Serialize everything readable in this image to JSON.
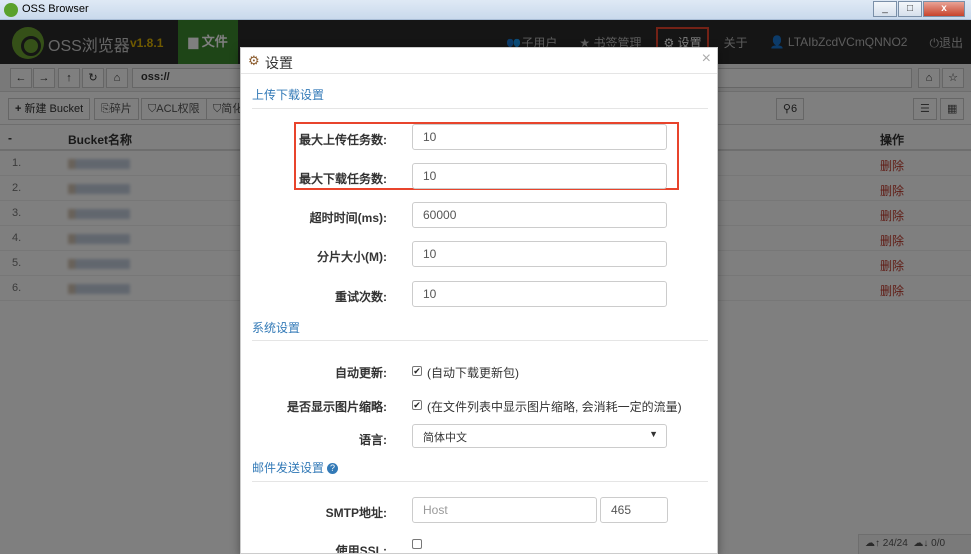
{
  "window": {
    "title": "OSS Browser",
    "minimize": "_",
    "maximize": "□",
    "close": "x"
  },
  "navbar": {
    "brand": "OSS浏览器",
    "version": "v1.8.1",
    "files_tab": "文件",
    "items": {
      "sub_users": "子用户",
      "bookmarks": "书签管理",
      "settings": "设置",
      "about": "关于",
      "account": "LTAIbZcdVCmQNNO2",
      "logout": "退出"
    }
  },
  "address": {
    "value": "oss://"
  },
  "toolbar": {
    "new_bucket": "新建 Bucket",
    "fragments": "碎片",
    "acl": "ACL权限",
    "simple": "简化",
    "search_count": "6"
  },
  "table": {
    "headers": {
      "dash": "-",
      "name": "Bucket名称",
      "ops": "操作"
    },
    "rows": [
      {
        "index": "1.",
        "op": "删除"
      },
      {
        "index": "2.",
        "op": "删除"
      },
      {
        "index": "3.",
        "op": "删除"
      },
      {
        "index": "4.",
        "op": "删除"
      },
      {
        "index": "5.",
        "op": "删除"
      },
      {
        "index": "6.",
        "op": "删除"
      }
    ]
  },
  "status": {
    "upload": "24/24",
    "download": "0/0"
  },
  "modal": {
    "title": "设置",
    "close": "×",
    "sections": {
      "transfer": "上传下载设置",
      "system": "系统设置",
      "mail": "邮件发送设置"
    },
    "fields": {
      "max_upload_label": "最大上传任务数:",
      "max_upload_value": "10",
      "max_download_label": "最大下载任务数:",
      "max_download_value": "10",
      "timeout_label": "超时时间(ms):",
      "timeout_value": "60000",
      "chunk_label": "分片大小(M):",
      "chunk_value": "10",
      "retry_label": "重试次数:",
      "retry_value": "10",
      "auto_update_label": "自动更新:",
      "auto_update_text": "(自动下载更新包)",
      "auto_update_checked": true,
      "thumbs_label": "是否显示图片缩略:",
      "thumbs_text": "(在文件列表中显示图片缩略, 会消耗一定的流量)",
      "thumbs_checked": true,
      "lang_label": "语言:",
      "lang_value": "简体中文",
      "smtp_label": "SMTP地址:",
      "smtp_host_placeholder": "Host",
      "smtp_port_value": "465",
      "ssl_label": "使用SSL:",
      "ssl_checked": false
    }
  },
  "colors": {
    "accent": "#337ab7",
    "highlight": "#e8442c",
    "nav_bg": "#2b2b2b",
    "files_tab": "#3c8a2e",
    "delete": "#c0392b"
  }
}
